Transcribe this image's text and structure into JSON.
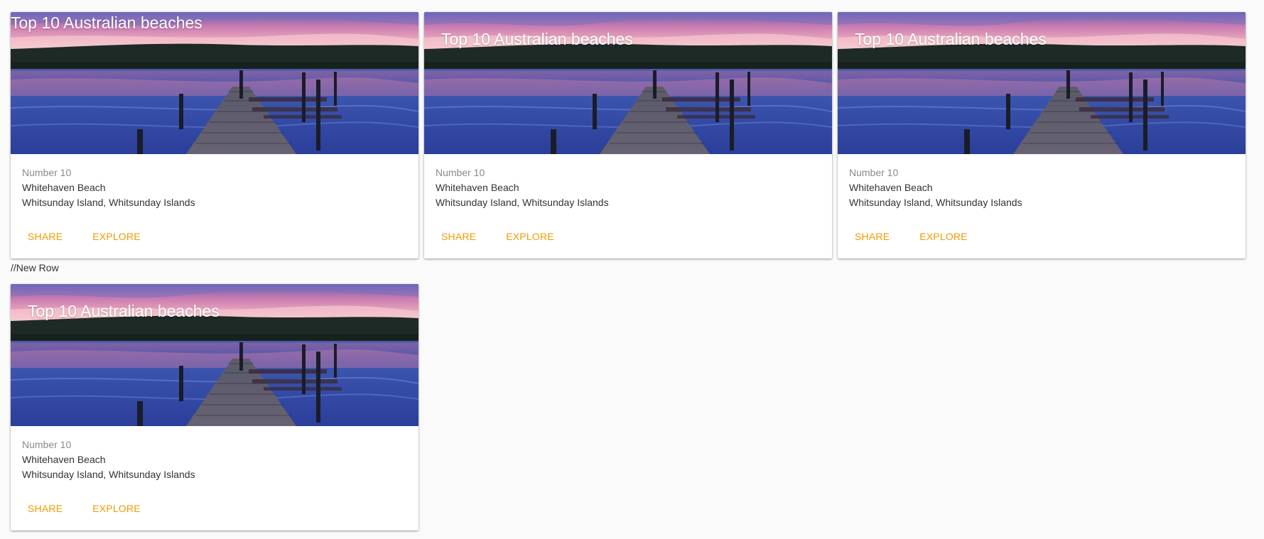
{
  "row_separator": "//New Row",
  "cards": [
    {
      "title": "Top 10 Australian beaches",
      "subtitle": "Number 10",
      "name": "Whitehaven Beach",
      "location": "Whitsunday Island, Whitsunday Islands",
      "actions": [
        "SHARE",
        "EXPLORE"
      ]
    },
    {
      "title": "Top 10 Australian beaches",
      "subtitle": "Number 10",
      "name": "Whitehaven Beach",
      "location": "Whitsunday Island, Whitsunday Islands",
      "actions": [
        "SHARE",
        "EXPLORE"
      ]
    },
    {
      "title": "Top 10 Australian beaches",
      "subtitle": "Number 10",
      "name": "Whitehaven Beach",
      "location": "Whitsunday Island, Whitsunday Islands",
      "actions": [
        "SHARE",
        "EXPLORE"
      ]
    },
    {
      "title": "Top 10 Australian beaches",
      "subtitle": "Number 10",
      "name": "Whitehaven Beach",
      "location": "Whitsunday Island, Whitsunday Islands",
      "actions": [
        "SHARE",
        "EXPLORE"
      ]
    }
  ],
  "theme": {
    "accent": "#f29b00",
    "background": "#fafafa",
    "card": "#ffffff"
  }
}
